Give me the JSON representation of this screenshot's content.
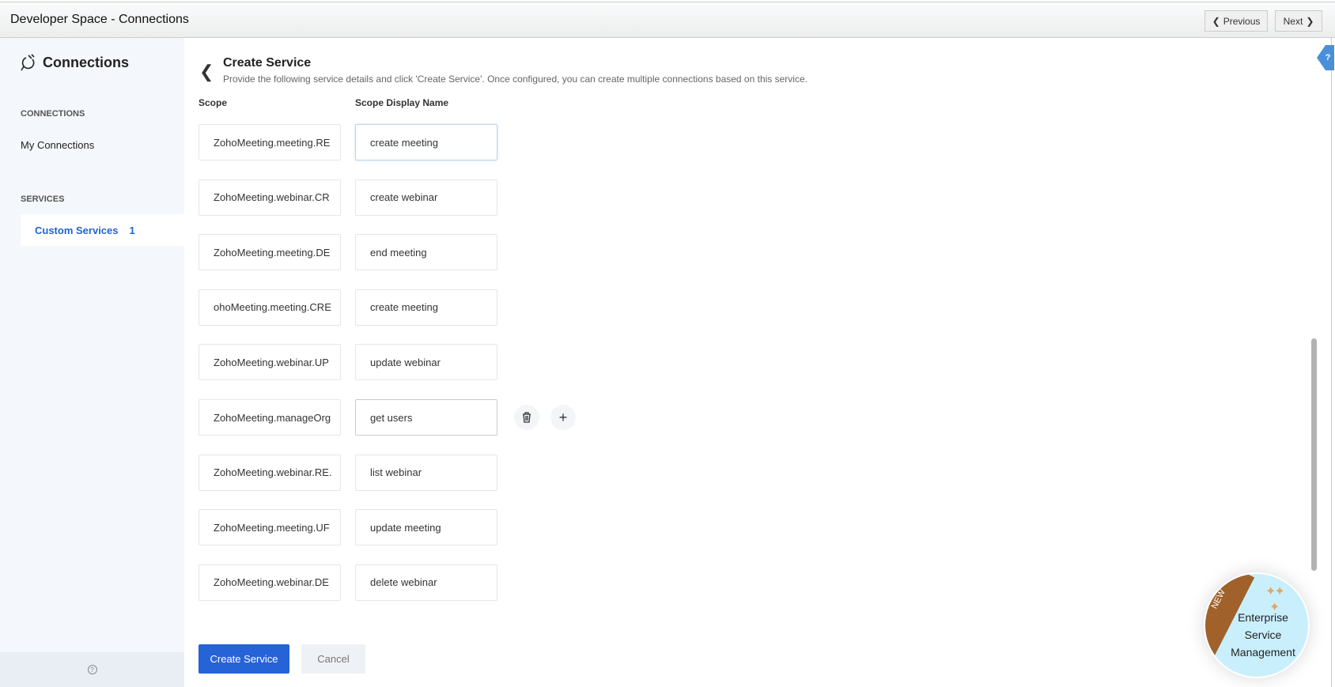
{
  "window": {
    "title": "Developer Space - Connections",
    "previous_label": "Previous",
    "next_label": "Next"
  },
  "sidebar": {
    "title": "Connections",
    "section_connections": "CONNECTIONS",
    "my_connections": "My Connections",
    "section_services": "SERVICES",
    "custom_services": "Custom Services",
    "custom_services_count": "1"
  },
  "main": {
    "title": "Create Service",
    "subtitle": "Provide the following service details and click 'Create Service'. Once configured, you can create multiple connections based on this service.",
    "col_scope": "Scope",
    "col_display": "Scope Display Name",
    "rows": [
      {
        "scope": "ZohoMeeting.meeting.RE",
        "display": "create meeting"
      },
      {
        "scope": "ZohoMeeting.webinar.CR",
        "display": "create webinar"
      },
      {
        "scope": "ZohoMeeting.meeting.DE",
        "display": "end meeting"
      },
      {
        "scope": "ohoMeeting.meeting.CRE",
        "display": "create meeting"
      },
      {
        "scope": "ZohoMeeting.webinar.UP",
        "display": "update webinar"
      },
      {
        "scope": "ZohoMeeting.manageOrg",
        "display": "get users"
      },
      {
        "scope": "ZohoMeeting.webinar.RE.",
        "display": "list webinar"
      },
      {
        "scope": "ZohoMeeting.meeting.UF",
        "display": "update meeting"
      },
      {
        "scope": "ZohoMeeting.webinar.DE",
        "display": "delete webinar"
      }
    ],
    "create_label": "Create Service",
    "cancel_label": "Cancel"
  },
  "help": "?",
  "promo": {
    "ribbon": "NEW",
    "text_line1": "Enterprise",
    "text_line2": "Service",
    "text_line3": "Management"
  },
  "colors": {
    "primary": "#2563d6",
    "sidebar_bg": "#f4f7fb",
    "ribbon": "#a0612a",
    "badge_bg": "#c9effd"
  }
}
